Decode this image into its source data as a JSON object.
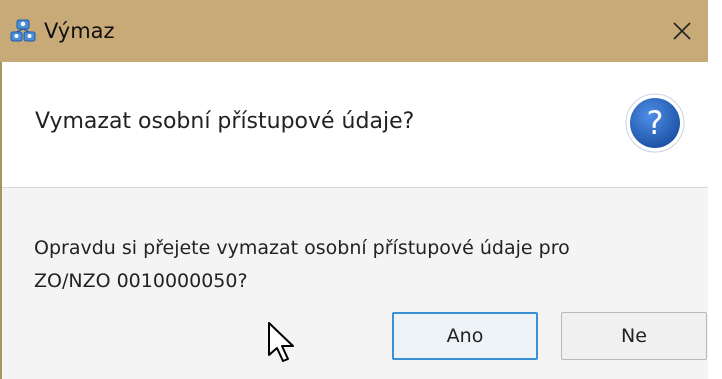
{
  "window": {
    "title": "Výmaz",
    "title_icon": "network-users-icon",
    "close_glyph": "✕"
  },
  "dialog": {
    "header_text": "Vymazat osobní přístupové údaje?",
    "header_icon": "question-icon",
    "header_icon_glyph": "?",
    "message_line1": "Opravdu si přejete vymazat osobní přístupové údaje pro",
    "message_line2": "ZO/NZO 0010000050?",
    "buttons": {
      "yes": "Ano",
      "no": "Ne"
    }
  },
  "colors": {
    "titlebar": "#c8a978",
    "accent": "#3d8fd6",
    "question_icon": "#1f5fb4"
  }
}
